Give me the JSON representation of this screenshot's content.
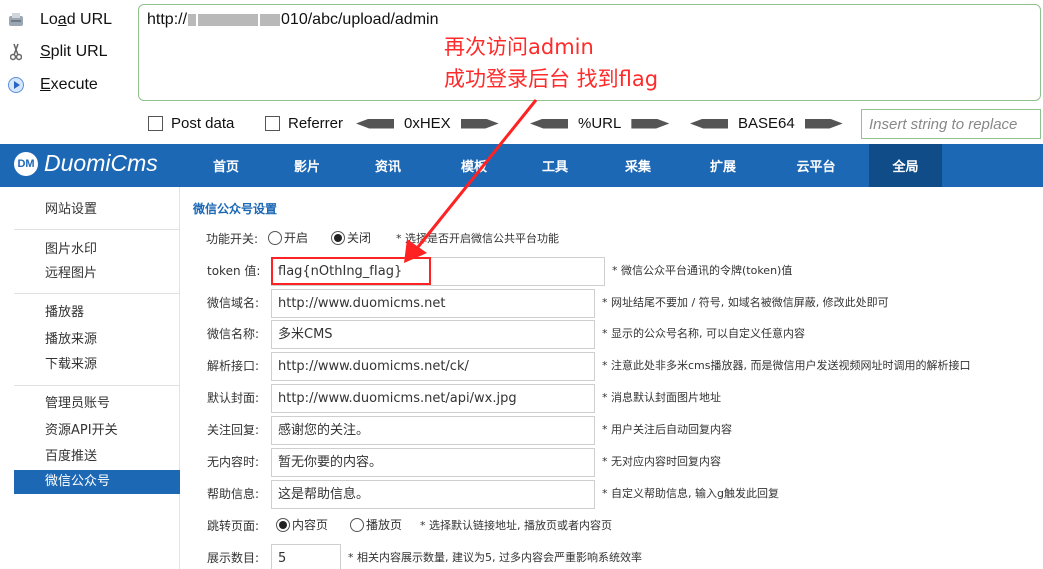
{
  "hackbar": {
    "buttons": {
      "load_url": {
        "pre": "Lo",
        "key": "a",
        "post": "d URL"
      },
      "split_url": {
        "pre": "",
        "key": "S",
        "post": "plit URL"
      },
      "execute": {
        "pre": "",
        "key": "E",
        "post": "xecute"
      }
    },
    "url": {
      "prefix": "http://",
      "suffix": "010/abc/upload/admin"
    },
    "notes": [
      "再次访问admin",
      "成功登录后台  找到flag"
    ],
    "options": {
      "post_data": "Post data",
      "referrer": "Referrer",
      "hex": "0xHEX",
      "url": "%URL",
      "base64": "BASE64"
    },
    "replace_placeholder": "Insert string to replace"
  },
  "brand": {
    "mark": "DM",
    "name": "DuomiCms"
  },
  "nav": {
    "items": [
      "首页",
      "影片",
      "资讯",
      "模板",
      "工具",
      "采集",
      "扩展",
      "云平台",
      "全局"
    ],
    "active": "全局"
  },
  "sidebar": {
    "items": [
      "网站设置",
      "图片水印",
      "远程图片",
      "播放器",
      "播放来源",
      "下载来源",
      "管理员账号",
      "资源API开关",
      "百度推送",
      "微信公众号"
    ],
    "active": "微信公众号"
  },
  "form": {
    "section_title": "微信公众号设置",
    "switch": {
      "label": "功能开关:",
      "on": "开启",
      "off": "关闭",
      "selected": "off",
      "hint": "* 选择是否开启微信公共平台功能"
    },
    "fields": [
      {
        "label": "token 值:",
        "value": "flag{nOthIng_fIag}",
        "hint": "* 微信公众平台通讯的令牌(token)值"
      },
      {
        "label": "微信域名:",
        "value": "http://www.duomicms.net",
        "hint": "* 网址结尾不要加 / 符号, 如域名被微信屏蔽, 修改此处即可"
      },
      {
        "label": "微信名称:",
        "value": "多米CMS",
        "hint": "* 显示的公众号名称, 可以自定义任意内容"
      },
      {
        "label": "解析接口:",
        "value": "http://www.duomicms.net/ck/",
        "hint": "* 注意此处非多米cms播放器, 而是微信用户发送视频网址时调用的解析接口"
      },
      {
        "label": "默认封面:",
        "value": "http://www.duomicms.net/api/wx.jpg",
        "hint": "* 消息默认封面图片地址"
      },
      {
        "label": "关注回复:",
        "value": "感谢您的关注。",
        "hint": "* 用户关注后自动回复内容"
      },
      {
        "label": "无内容时:",
        "value": "暂无你要的内容。",
        "hint": "* 无对应内容时回复内容"
      },
      {
        "label": "帮助信息:",
        "value": "这是帮助信息。",
        "hint": "* 自定义帮助信息, 输入g触发此回复"
      }
    ],
    "jump": {
      "label": "跳转页面:",
      "content": "内容页",
      "play": "播放页",
      "selected": "content",
      "hint": "* 选择默认链接地址, 播放页或者内容页"
    },
    "count": {
      "label": "展示数目:",
      "value": "5",
      "hint": "* 相关内容展示数量, 建议为5, 过多内容会严重影响系统效率"
    }
  },
  "colors": {
    "accent": "#1c68b5",
    "annotation": "#ff2222"
  }
}
